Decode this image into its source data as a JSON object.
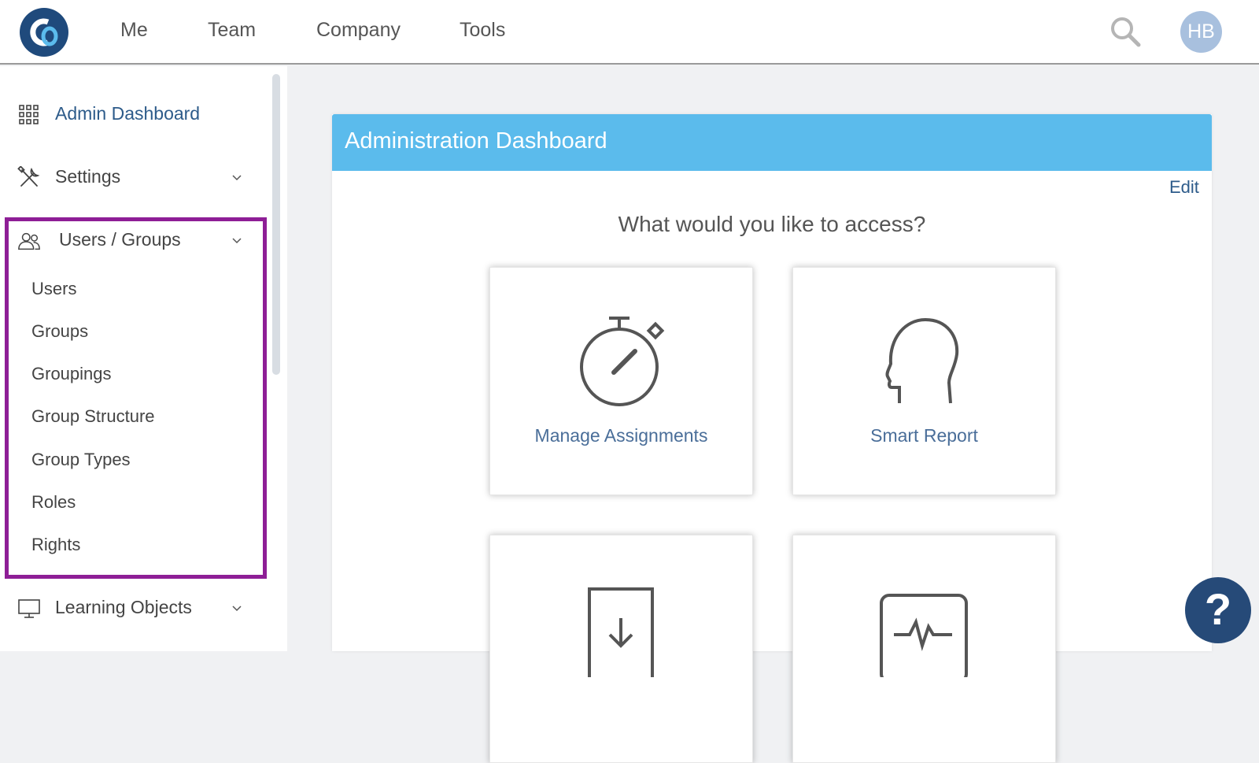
{
  "topnav": {
    "items": [
      {
        "label": "Me"
      },
      {
        "label": "Team"
      },
      {
        "label": "Company"
      },
      {
        "label": "Tools"
      }
    ],
    "search_icon": "magnifier",
    "avatar_initials": "HB"
  },
  "sidebar": {
    "items": [
      {
        "label": "Admin Dashboard",
        "icon": "grid-icon",
        "active": true
      },
      {
        "label": "Settings",
        "icon": "tools-icon"
      },
      {
        "label": "Users / Groups",
        "icon": "users-icon",
        "expanded": true
      },
      {
        "label": "Learning Objects",
        "icon": "monitor-icon"
      }
    ],
    "users_groups_subitems": [
      "Users",
      "Groups",
      "Groupings",
      "Group Structure",
      "Group Types",
      "Roles",
      "Rights"
    ]
  },
  "panel": {
    "title": "Administration Dashboard",
    "edit_label": "Edit",
    "question": "What would you like to access?",
    "tiles": [
      {
        "label": "Manage Assignments",
        "icon": "stopwatch-icon"
      },
      {
        "label": "Smart Report",
        "icon": "head-profile-icon"
      },
      {
        "label": "",
        "icon": "download-document-icon"
      },
      {
        "label": "",
        "icon": "pulse-monitor-icon"
      }
    ]
  },
  "help_label": "?",
  "colors": {
    "header_blue": "#5bbbec",
    "highlight_purple": "#8e1e96",
    "brand_navy": "#1f4a7c",
    "link_blue": "#2d5b8a"
  }
}
